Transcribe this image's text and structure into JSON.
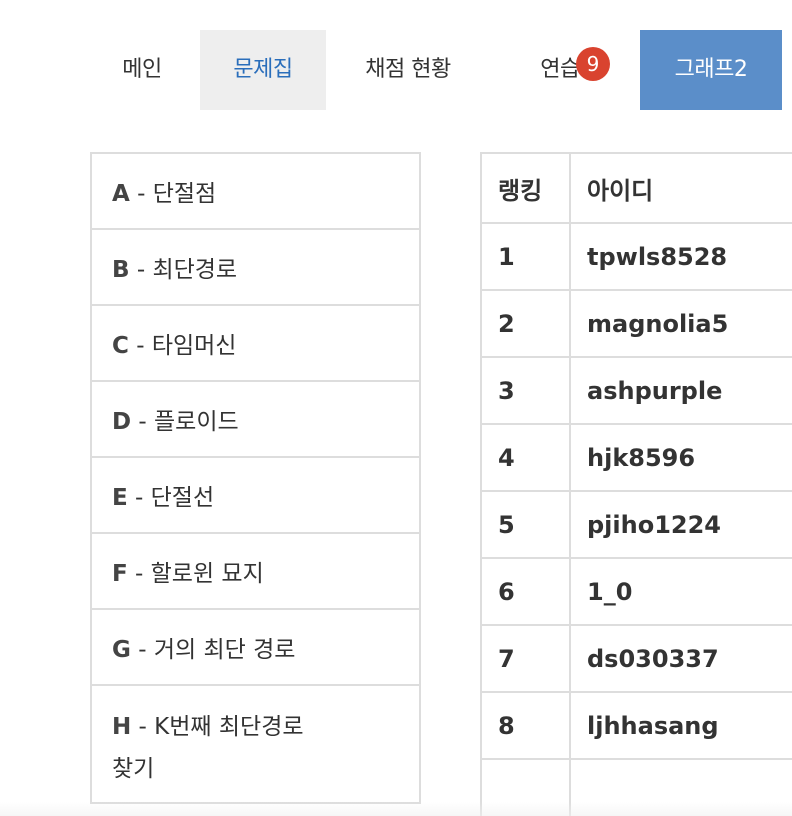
{
  "nav": {
    "main": "메인",
    "problems": "문제집",
    "status": "채점 현황",
    "practice": "연습",
    "practice_badge": "9",
    "graph": "그래프2"
  },
  "problems": [
    {
      "letter": "A",
      "sep": " - ",
      "title": "단절점"
    },
    {
      "letter": "B",
      "sep": " - ",
      "title": "최단경로"
    },
    {
      "letter": "C",
      "sep": " - ",
      "title": "타임머신"
    },
    {
      "letter": "D",
      "sep": " - ",
      "title": "플로이드"
    },
    {
      "letter": "E",
      "sep": " - ",
      "title": "단절선"
    },
    {
      "letter": "F",
      "sep": " - ",
      "title": "할로윈 묘지"
    },
    {
      "letter": "G",
      "sep": " - ",
      "title": "거의 최단 경로"
    },
    {
      "letter": "H",
      "sep": " - ",
      "title": "K번째 최단경로 찾기"
    }
  ],
  "ranking": {
    "headers": {
      "rank": "랭킹",
      "id": "아이디"
    },
    "rows": [
      {
        "rank": "1",
        "id": "tpwls8528"
      },
      {
        "rank": "2",
        "id": "magnolia5"
      },
      {
        "rank": "3",
        "id": "ashpurple"
      },
      {
        "rank": "4",
        "id": "hjk8596"
      },
      {
        "rank": "5",
        "id": "pjiho1224"
      },
      {
        "rank": "6",
        "id": "1_0"
      },
      {
        "rank": "7",
        "id": "ds030337"
      },
      {
        "rank": "8",
        "id": "ljhhasang"
      },
      {
        "rank": "",
        "id": ""
      }
    ]
  }
}
